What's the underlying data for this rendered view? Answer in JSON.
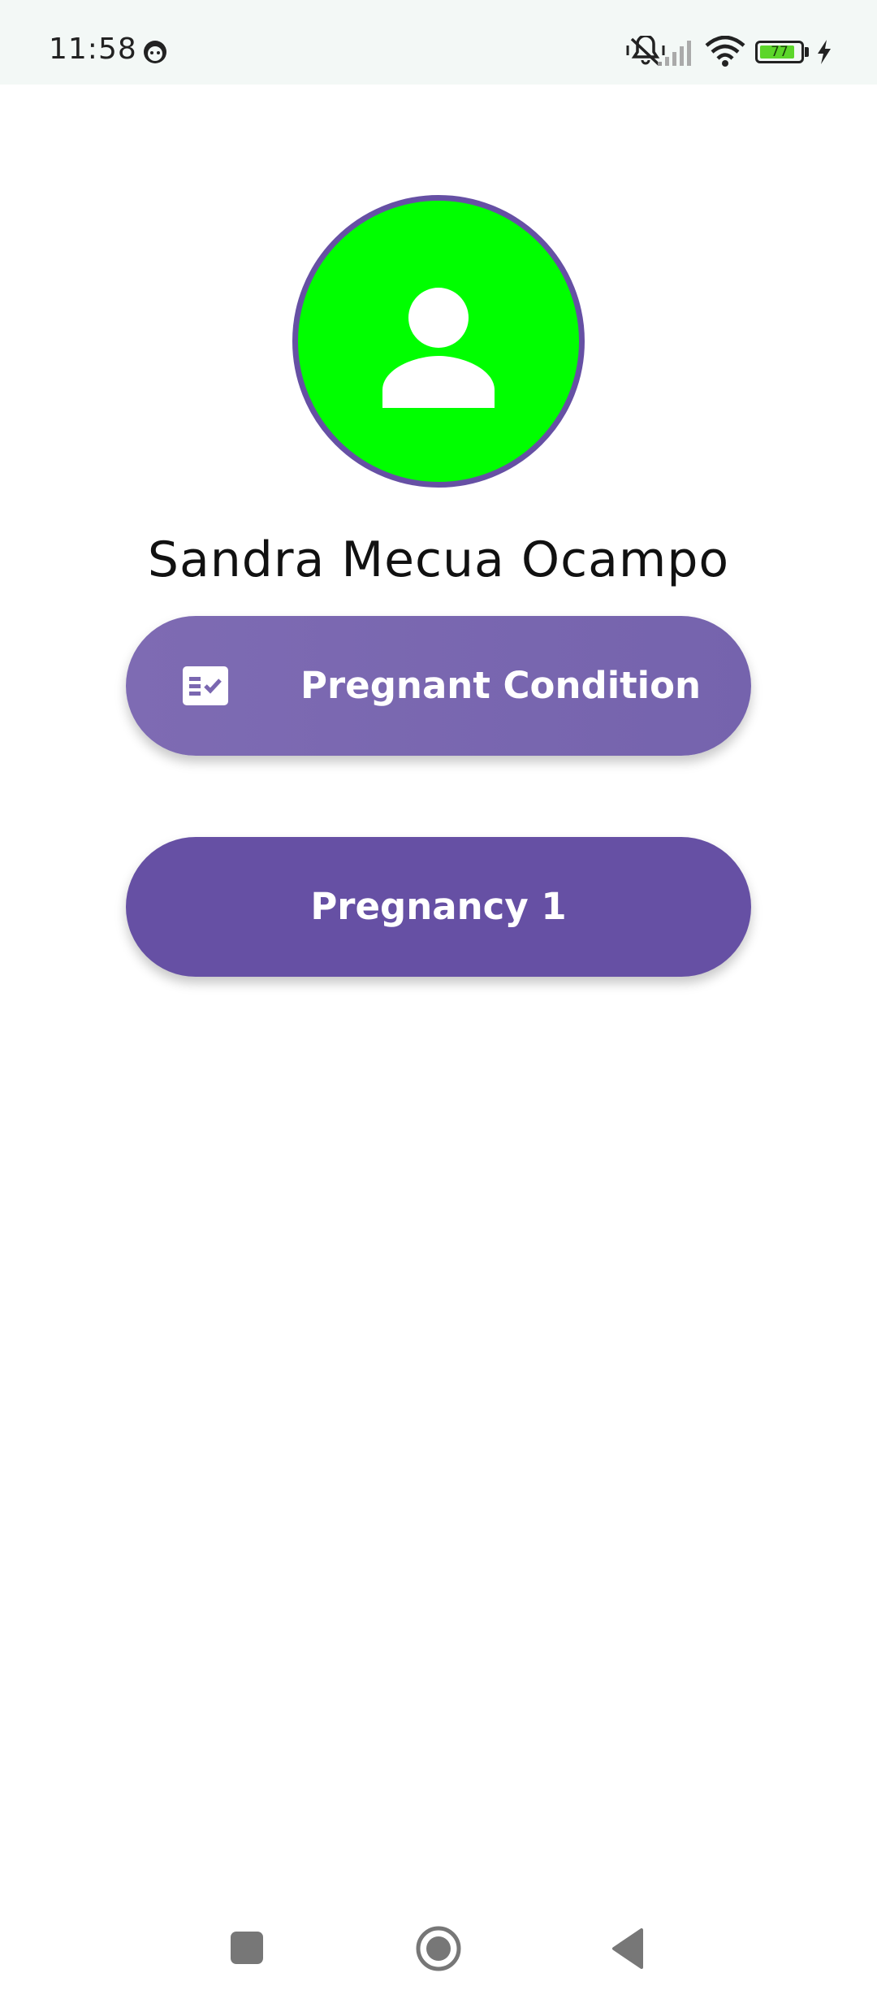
{
  "status_bar": {
    "time": "11:58",
    "battery_level": "77",
    "icons": [
      "cat-face-icon",
      "mute-vibrate-icon",
      "signal-icon",
      "wifi-icon",
      "battery-icon",
      "charging-bolt-icon"
    ]
  },
  "profile": {
    "avatar_icon": "person-icon",
    "avatar_color": "#00ff00",
    "avatar_border_color": "#6650a4",
    "name": "Sandra Mecua Ocampo"
  },
  "buttons": {
    "pregnant_condition": {
      "label": "Pregnant Condition",
      "icon": "checklist-icon",
      "color": "#7a67b0"
    },
    "pregnancy_1": {
      "label": "Pregnancy 1",
      "color": "#6650a4"
    }
  },
  "nav_bar": {
    "icons": [
      "recents-square-icon",
      "home-circle-icon",
      "back-triangle-icon"
    ]
  }
}
